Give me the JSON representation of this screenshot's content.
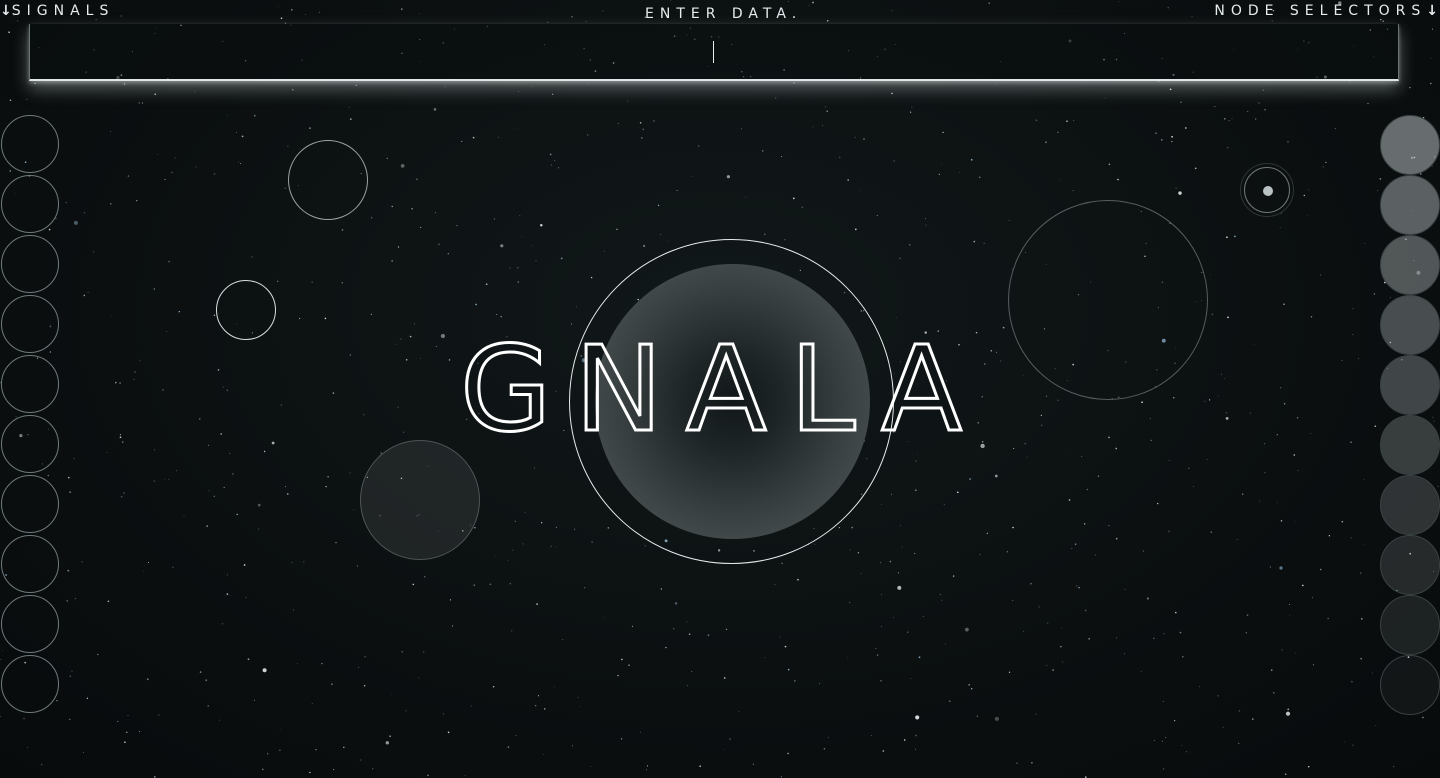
{
  "header": {
    "signals_label": "SIGNALS",
    "signals_arrow": "↓",
    "enter_label": "ENTER DATA.",
    "node_label": "NODE SELECTORS",
    "node_arrow": "↓"
  },
  "input": {
    "value": "",
    "placeholder": ""
  },
  "logo": {
    "text": "GNALA"
  },
  "signals": {
    "count": 10
  },
  "node_selectors": {
    "count": 10,
    "opacity_levels": [
      0.55,
      0.48,
      0.42,
      0.37,
      0.32,
      0.27,
      0.22,
      0.17,
      0.12,
      0.06
    ]
  },
  "colors": {
    "background": "#0b0f10",
    "foreground": "#e8eef0",
    "node_fill": "#b4bcbe"
  }
}
